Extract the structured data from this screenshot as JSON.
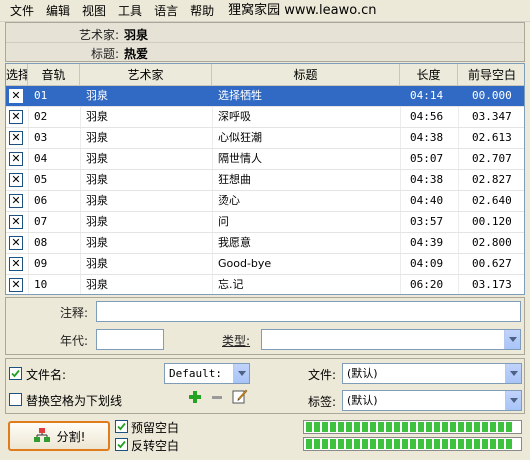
{
  "menu": {
    "items": [
      "文件",
      "编辑",
      "视图",
      "工具",
      "语言",
      "帮助"
    ],
    "brand": "狸窝家园 www.leawo.cn"
  },
  "info": {
    "artist_label": "艺术家:",
    "artist_value": "羽泉",
    "title_label": "标题:",
    "title_value": "热爱"
  },
  "table": {
    "columns": [
      "选择",
      "音轨",
      "艺术家",
      "标题",
      "长度",
      "前导空白"
    ],
    "rows": [
      {
        "checked": true,
        "track": "01",
        "artist": "羽泉",
        "title": "选择牺牲",
        "length": "04:14",
        "gap": "00.000",
        "selected": true
      },
      {
        "checked": true,
        "track": "02",
        "artist": "羽泉",
        "title": "深呼吸",
        "length": "04:56",
        "gap": "03.347",
        "selected": false
      },
      {
        "checked": true,
        "track": "03",
        "artist": "羽泉",
        "title": "心似狂潮",
        "length": "04:38",
        "gap": "02.613",
        "selected": false
      },
      {
        "checked": true,
        "track": "04",
        "artist": "羽泉",
        "title": "隔世情人",
        "length": "05:07",
        "gap": "02.707",
        "selected": false
      },
      {
        "checked": true,
        "track": "05",
        "artist": "羽泉",
        "title": "狂想曲",
        "length": "04:38",
        "gap": "02.827",
        "selected": false
      },
      {
        "checked": true,
        "track": "06",
        "artist": "羽泉",
        "title": "烫心",
        "length": "04:40",
        "gap": "02.640",
        "selected": false
      },
      {
        "checked": true,
        "track": "07",
        "artist": "羽泉",
        "title": "问",
        "length": "03:57",
        "gap": "00.120",
        "selected": false
      },
      {
        "checked": true,
        "track": "08",
        "artist": "羽泉",
        "title": "我愿意",
        "length": "04:39",
        "gap": "02.800",
        "selected": false
      },
      {
        "checked": true,
        "track": "09",
        "artist": "羽泉",
        "title": "Good-bye",
        "length": "04:09",
        "gap": "00.627",
        "selected": false
      },
      {
        "checked": true,
        "track": "10",
        "artist": "羽泉",
        "title": "忘.记",
        "length": "06:20",
        "gap": "03.173",
        "selected": false
      }
    ]
  },
  "fields": {
    "comment_label": "注释:",
    "comment_value": "",
    "year_label": "年代:",
    "year_value": "",
    "genre_label": "类型:",
    "genre_value": ""
  },
  "options": {
    "filename_label": "文件名:",
    "filename_checked": true,
    "filename_value": "Default:",
    "replace_space_label": "替换空格为下划线",
    "replace_space_checked": false,
    "file_label": "文件:",
    "file_value": "(默认)",
    "tag_label": "标签:",
    "tag_value": "(默认)",
    "keep_gap_label": "预留空白",
    "keep_gap_checked": true,
    "invert_gap_label": "反转空白",
    "invert_gap_checked": true
  },
  "split_button": "分割!",
  "progress": {
    "bar1_fraction": 1.0,
    "bar2_fraction": 1.0
  },
  "colors": {
    "selection": "#316ac5",
    "progress": "#3cc23c",
    "split_border": "#e07c1b"
  }
}
